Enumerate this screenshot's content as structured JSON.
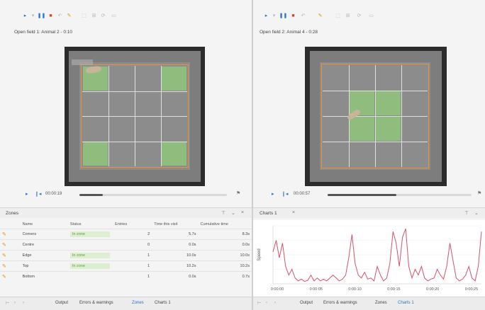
{
  "left": {
    "title": "Open field 1: Animal 2 - 0:10",
    "timecode": "00:00:19",
    "progress": 0.16,
    "arena_green_cells": [
      [
        0,
        0
      ],
      [
        0,
        3
      ],
      [
        3,
        0
      ],
      [
        3,
        3
      ]
    ],
    "panel_title": "Zones",
    "table": {
      "headers": [
        "Name",
        "Status",
        "Entries",
        "Time this visit",
        "Cumulative time"
      ],
      "rows": [
        {
          "name": "Corners",
          "status": "In zone",
          "entries": "2",
          "visit": "5.7s",
          "cumulative": "8.3s"
        },
        {
          "name": "Centre",
          "status": "",
          "entries": "0",
          "visit": "0.0s",
          "cumulative": "0.0s"
        },
        {
          "name": "Edge",
          "status": "In zone",
          "entries": "1",
          "visit": "10.0s",
          "cumulative": "10.0s"
        },
        {
          "name": "Top",
          "status": "In zone",
          "entries": "1",
          "visit": "10.2s",
          "cumulative": "10.2s"
        },
        {
          "name": "Bottom",
          "status": "",
          "entries": "1",
          "visit": "0.0s",
          "cumulative": "0.7s"
        }
      ]
    },
    "tabs": [
      "Output",
      "Errors & warnings",
      "Zones",
      "Charts 1"
    ],
    "active_tab": "Zones"
  },
  "right": {
    "title": "Open field 2: Animal 4 - 0:28",
    "timecode": "00:00:57",
    "progress": 0.48,
    "arena_green_cells": [
      [
        1,
        1
      ],
      [
        1,
        2
      ],
      [
        2,
        1
      ],
      [
        2,
        2
      ]
    ],
    "panel_title": "Charts 1",
    "tabs": [
      "Output",
      "Errors & warnings",
      "Zones",
      "Charts 1"
    ],
    "active_tab": "Charts 1"
  },
  "chart_data": {
    "type": "line",
    "title": "",
    "xlabel": "",
    "ylabel": "Speed",
    "x_ticks": [
      "0:00:00",
      "0:00:05",
      "0:00:10",
      "0:00:15",
      "0:00:20",
      "0:00:25"
    ],
    "color": "#d6526a",
    "series": [
      {
        "values": [
          0.55,
          0.75,
          0.45,
          0.7,
          0.3,
          0.15,
          0.25,
          0.1,
          0.05,
          0.08,
          0.04,
          0.06,
          0.15,
          0.05,
          0.1,
          0.05,
          0.08,
          0.05,
          0.1,
          0.15,
          0.1,
          0.05,
          0.08,
          0.15,
          0.45,
          0.85,
          0.35,
          0.15,
          0.1,
          0.2,
          0.08,
          0.1,
          0.05,
          0.3,
          0.15,
          0.05,
          0.1,
          0.35,
          0.9,
          0.7,
          0.3,
          0.8,
          0.95,
          0.3,
          0.1,
          0.25,
          0.15,
          0.3,
          0.1,
          0.05,
          0.08,
          0.1,
          0.25,
          0.15,
          0.08,
          0.3,
          0.7,
          0.4,
          0.1,
          0.05,
          0.08,
          0.15,
          0.3,
          0.1,
          0.05,
          0.3,
          0.9
        ]
      }
    ]
  }
}
